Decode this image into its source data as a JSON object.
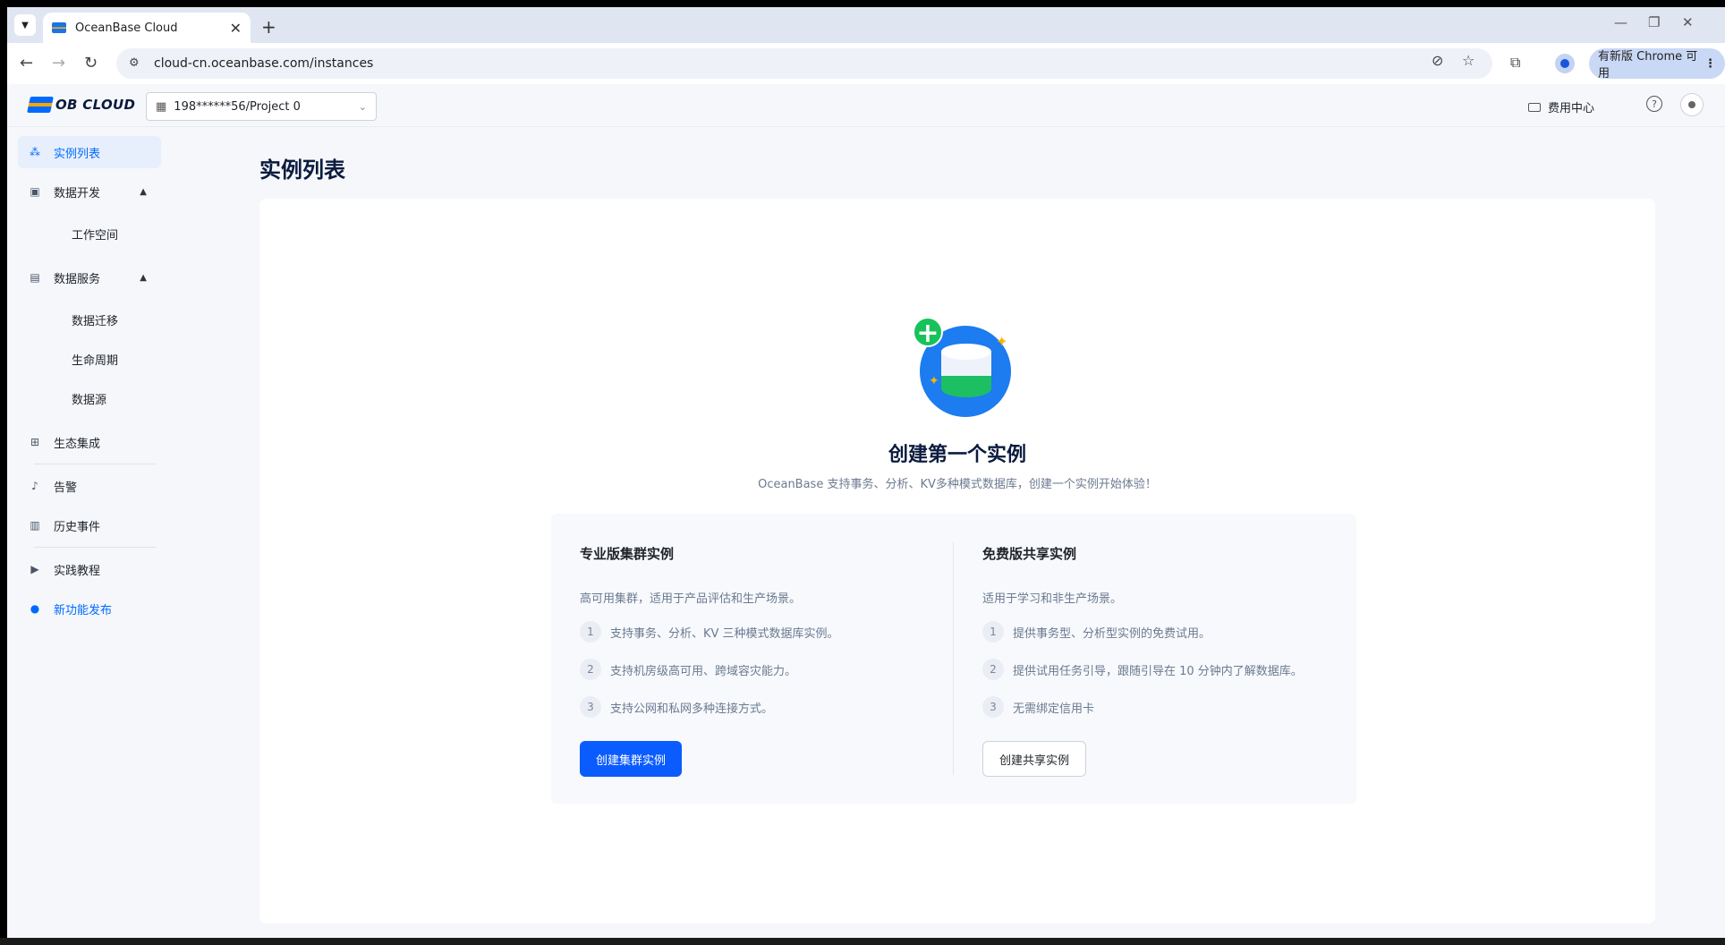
{
  "browser": {
    "tab_title": "OceanBase Cloud",
    "url": "cloud-cn.oceanbase.com/instances",
    "update_label": "有新版 Chrome 可用"
  },
  "header": {
    "logo_text": "OB CLOUD",
    "project_selector": "198******56/Project 0",
    "billing_label": "费用中心"
  },
  "sidebar": {
    "instances": "实例列表",
    "data_dev": "数据开发",
    "workspace": "工作空间",
    "data_services": "数据服务",
    "data_migration": "数据迁移",
    "lifecycle": "生命周期",
    "data_source": "数据源",
    "ecosystem": "生态集成",
    "alerts": "告警",
    "history": "历史事件",
    "tutorials": "实践教程",
    "new_features": "新功能发布"
  },
  "main": {
    "page_title": "实例列表",
    "hero_title": "创建第一个实例",
    "hero_desc": "OceanBase 支持事务、分析、KV多种模式数据库，创建一个实例开始体验！",
    "pro": {
      "title": "专业版集群实例",
      "subtitle": "高可用集群，适用于产品评估和生产场景。",
      "items": [
        {
          "n": "1",
          "text": "支持事务、分析、KV 三种模式数据库实例。"
        },
        {
          "n": "2",
          "text": "支持机房级高可用、跨域容灾能力。"
        },
        {
          "n": "3",
          "text": "支持公网和私网多种连接方式。"
        }
      ],
      "button": "创建集群实例"
    },
    "free": {
      "title": "免费版共享实例",
      "subtitle": "适用于学习和非生产场景。",
      "items": [
        {
          "n": "1",
          "text": "提供事务型、分析型实例的免费试用。"
        },
        {
          "n": "2",
          "text": "提供试用任务引导，跟随引导在 10 分钟内了解数据库。"
        },
        {
          "n": "3",
          "text": "无需绑定信用卡"
        }
      ],
      "button": "创建共享实例"
    }
  },
  "colors": {
    "primary": "#0b5cff",
    "active_nav_bg": "#e8effc",
    "link_blue": "#006aff",
    "hero_green": "#18c25a"
  }
}
